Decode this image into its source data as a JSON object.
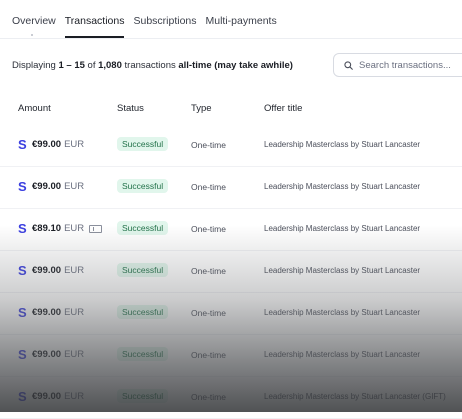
{
  "tabs": [
    {
      "label": "Overview",
      "active": false
    },
    {
      "label": "Transactions",
      "active": true
    },
    {
      "label": "Subscriptions",
      "active": false
    },
    {
      "label": "Multi-payments",
      "active": false
    }
  ],
  "summary": {
    "prefix": "Displaying ",
    "range": "1 – 15",
    "of": " of ",
    "total": "1,080",
    "middle": " transactions ",
    "scope": "all-time (may take awhile)"
  },
  "search": {
    "placeholder": "Search transactions..."
  },
  "table": {
    "columns": [
      "Amount",
      "Status",
      "Type",
      "Offer title"
    ],
    "rows": [
      {
        "logo": "S",
        "amount": "€99.00",
        "currency": "EUR",
        "coupon": false,
        "status": "Successful",
        "type": "One-time",
        "offer": "Leadership Masterclass by Stuart Lancaster"
      },
      {
        "logo": "S",
        "amount": "€99.00",
        "currency": "EUR",
        "coupon": false,
        "status": "Successful",
        "type": "One-time",
        "offer": "Leadership Masterclass by Stuart Lancaster"
      },
      {
        "logo": "S",
        "amount": "€89.10",
        "currency": "EUR",
        "coupon": true,
        "status": "Successful",
        "type": "One-time",
        "offer": "Leadership Masterclass by Stuart Lancaster"
      },
      {
        "logo": "S",
        "amount": "€99.00",
        "currency": "EUR",
        "coupon": false,
        "status": "Successful",
        "type": "One-time",
        "offer": "Leadership Masterclass by Stuart Lancaster"
      },
      {
        "logo": "S",
        "amount": "€99.00",
        "currency": "EUR",
        "coupon": false,
        "status": "Successful",
        "type": "One-time",
        "offer": "Leadership Masterclass by Stuart Lancaster"
      },
      {
        "logo": "S",
        "amount": "€99.00",
        "currency": "EUR",
        "coupon": false,
        "status": "Successful",
        "type": "One-time",
        "offer": "Leadership Masterclass by Stuart Lancaster"
      },
      {
        "logo": "S",
        "amount": "€99.00",
        "currency": "EUR",
        "coupon": false,
        "status": "Successful",
        "type": "One-time",
        "offer": "Leadership Masterclass by Stuart Lancaster (GIFT)"
      }
    ]
  },
  "colors": {
    "brand": "#3b3fe0",
    "success_bg": "#e1f6ec",
    "success_text": "#22724a"
  },
  "icons": {
    "search": "search-icon",
    "payment": "stripe-logo-icon",
    "coupon": "coupon-icon"
  }
}
